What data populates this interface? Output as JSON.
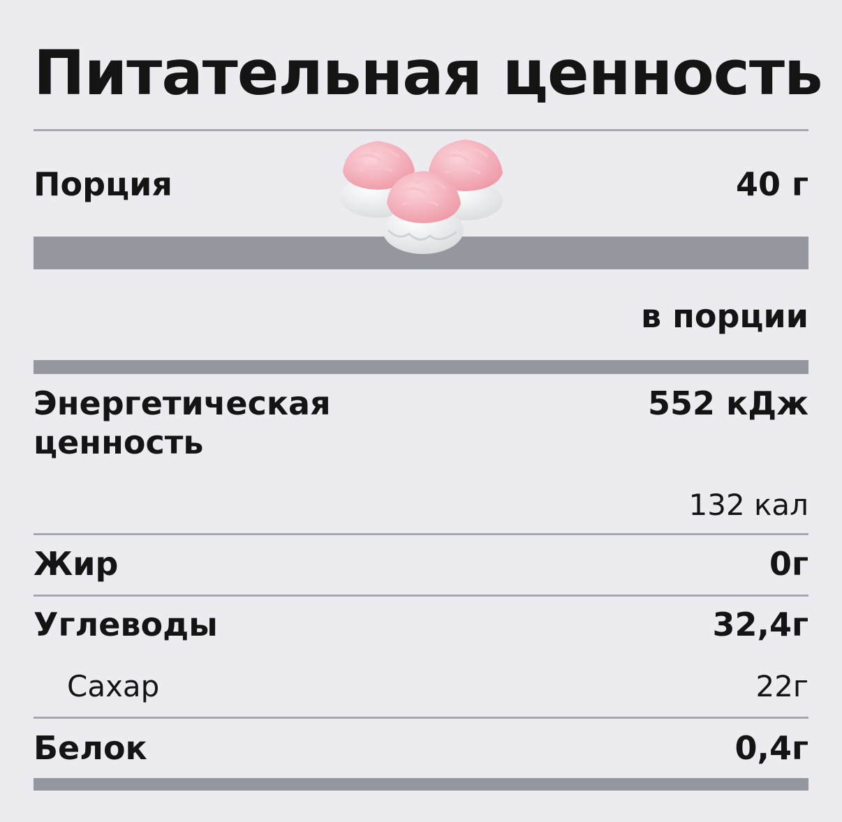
{
  "title": "Питательная ценность",
  "serving": {
    "label": "Порция",
    "value": "40 г"
  },
  "column_header": "в порции",
  "energy": {
    "label_line1": "Энергетическая",
    "label_line2": "ценность",
    "value_kj": "552 кДж",
    "value_kcal": "132 кал"
  },
  "fat": {
    "label": "Жир",
    "value": "0г"
  },
  "carbs": {
    "label": "Углеводы",
    "value": "32,4г"
  },
  "sugar": {
    "label": "Сахар",
    "value": "22г"
  },
  "protein": {
    "label": "Белок",
    "value": "0,4г"
  },
  "colors": {
    "background": "#ebebf0",
    "bar": "#95979f",
    "divider": "#a6a6b0",
    "text": "#141414",
    "marshmallow_pink": "#f4aeb8",
    "marshmallow_white": "#f5f5f5"
  },
  "image": {
    "icon": "marshmallow-icon"
  }
}
